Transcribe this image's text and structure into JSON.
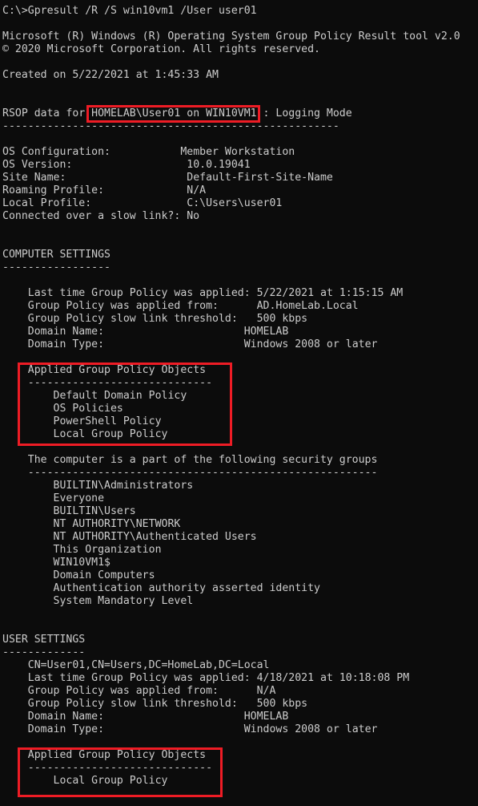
{
  "terminal": {
    "colors": {
      "background": "#0c0c0c",
      "foreground": "#cccccc",
      "highlight": "#ee1c25"
    },
    "prompt_line": "C:\\>Gpresult /R /S win10vm1 /User user01",
    "banner": [
      "Microsoft (R) Windows (R) Operating System Group Policy Result tool v2.0",
      "© 2020 Microsoft Corporation. All rights reserved."
    ],
    "created_on": "Created on ‎5/‎22/‎2021 at 1:45:33 AM",
    "rsop": {
      "prefix": "RSOP data for ",
      "target": "HOMELAB\\User01 on WIN10VM1",
      "suffix": " : Logging Mode",
      "separator": "-----------------------------------------------------"
    },
    "system_info": [
      {
        "label": "OS Configuration:",
        "value": "Member Workstation"
      },
      {
        "label": "OS Version:",
        "value": "10.0.19041"
      },
      {
        "label": "Site Name:",
        "value": "Default-First-Site-Name"
      },
      {
        "label": "Roaming Profile:",
        "value": "N/A"
      },
      {
        "label": "Local Profile:",
        "value": "C:\\Users\\user01"
      }
    ],
    "slow_link_line": "Connected over a slow link?: No",
    "computer_settings": {
      "heading": "COMPUTER SETTINGS",
      "separator": "-----------------",
      "info": [
        {
          "label": "Last time Group Policy was applied:",
          "value": "5/22/2021 at 1:15:15 AM"
        },
        {
          "label": "Group Policy was applied from:",
          "value": "AD.HomeLab.Local"
        },
        {
          "label": "Group Policy slow link threshold:",
          "value": "500 kbps"
        },
        {
          "label": "Domain Name:",
          "value": "HOMELAB"
        },
        {
          "label": "Domain Type:",
          "value": "Windows 2008 or later"
        }
      ],
      "applied_gpos": {
        "heading": "Applied Group Policy Objects",
        "separator": "-----------------------------",
        "items": [
          "Default Domain Policy",
          "OS Policies",
          "PowerShell Policy",
          "Local Group Policy"
        ]
      },
      "security_groups": {
        "heading": "The computer is a part of the following security groups",
        "separator": "-------------------------------------------------------",
        "items": [
          "BUILTIN\\Administrators",
          "Everyone",
          "BUILTIN\\Users",
          "NT AUTHORITY\\NETWORK",
          "NT AUTHORITY\\Authenticated Users",
          "This Organization",
          "WIN10VM1$",
          "Domain Computers",
          "Authentication authority asserted identity",
          "System Mandatory Level"
        ]
      }
    },
    "user_settings": {
      "heading": "USER SETTINGS",
      "separator": "-------------",
      "distinguished_name": "CN=User01,CN=Users,DC=HomeLab,DC=Local",
      "info": [
        {
          "label": "Last time Group Policy was applied:",
          "value": "4/18/2021 at 10:18:08 PM"
        },
        {
          "label": "Group Policy was applied from:",
          "value": "N/A"
        },
        {
          "label": "Group Policy slow link threshold:",
          "value": "500 kbps"
        },
        {
          "label": "Domain Name:",
          "value": "HOMELAB"
        },
        {
          "label": "Domain Type:",
          "value": "Windows 2008 or later"
        }
      ],
      "applied_gpos": {
        "heading": "Applied Group Policy Objects",
        "separator": "-----------------------------",
        "items": [
          "Local Group Policy"
        ]
      }
    }
  }
}
